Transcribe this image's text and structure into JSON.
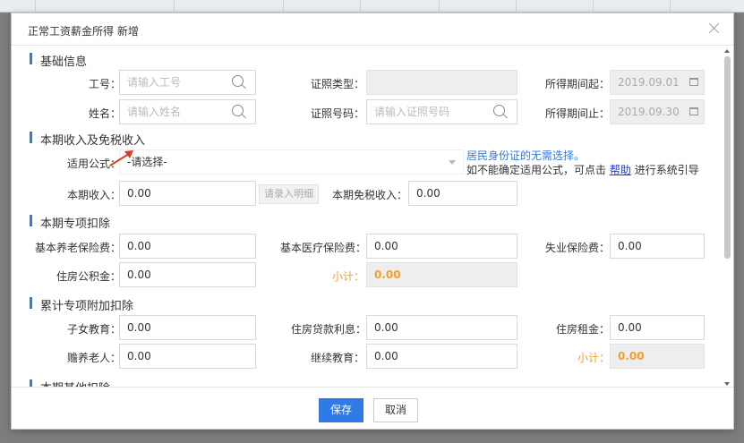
{
  "dialog": {
    "title": "正常工资薪金所得 新增"
  },
  "basic_info": {
    "section_title": "基础信息",
    "employee_no_label": "工号：",
    "employee_no_placeholder": "请输入工号",
    "id_type_label": "证照类型：",
    "id_type_value": "",
    "period_start_label": "所得期间起：",
    "period_start_value": "2019.09.01",
    "name_label": "姓名：",
    "name_placeholder": "请输入姓名",
    "id_no_label": "证照号码：",
    "id_no_placeholder": "请输入证照号码",
    "period_end_label": "所得期间止：",
    "period_end_value": "2019.09.30"
  },
  "income": {
    "section_title": "本期收入及免税收入",
    "formula_label": "适用公式：",
    "formula_value": "-请选择-",
    "hint_line1": "居民身份证的无需选择。",
    "hint_line2_prefix": "如不能确定适用公式，可点击",
    "help_link": "帮助",
    "hint_line2_suffix": "进行系统引导",
    "current_income_label": "本期收入：",
    "current_income_value": "0.00",
    "detail_button": "请录入明细",
    "tax_free_label": "本期免税收入：",
    "tax_free_value": "0.00"
  },
  "special_deduction": {
    "section_title": "本期专项扣除",
    "pension_label": "基本养老保险费：",
    "pension_value": "0.00",
    "medical_label": "基本医疗保险费：",
    "medical_value": "0.00",
    "unemployment_label": "失业保险费：",
    "unemployment_value": "0.00",
    "housing_fund_label": "住房公积金：",
    "housing_fund_value": "0.00",
    "subtotal_label": "小计：",
    "subtotal_value": "0.00"
  },
  "additional_deduction": {
    "section_title": "累计专项附加扣除",
    "children_edu_label": "子女教育：",
    "children_edu_value": "0.00",
    "mortgage_label": "住房贷款利息：",
    "mortgage_value": "0.00",
    "rent_label": "住房租金：",
    "rent_value": "0.00",
    "elderly_label": "赡养老人：",
    "elderly_value": "0.00",
    "continuing_edu_label": "继续教育：",
    "continuing_edu_value": "0.00",
    "subtotal_label": "小计：",
    "subtotal_value": "0.00"
  },
  "other_deduction": {
    "section_title": "本期其他扣除"
  },
  "footer": {
    "save_label": "保存",
    "cancel_label": "取消"
  },
  "colors": {
    "accent": "#2f7ae5",
    "subtotal": "#f0a030",
    "annotation_arrow": "#d83a22"
  }
}
